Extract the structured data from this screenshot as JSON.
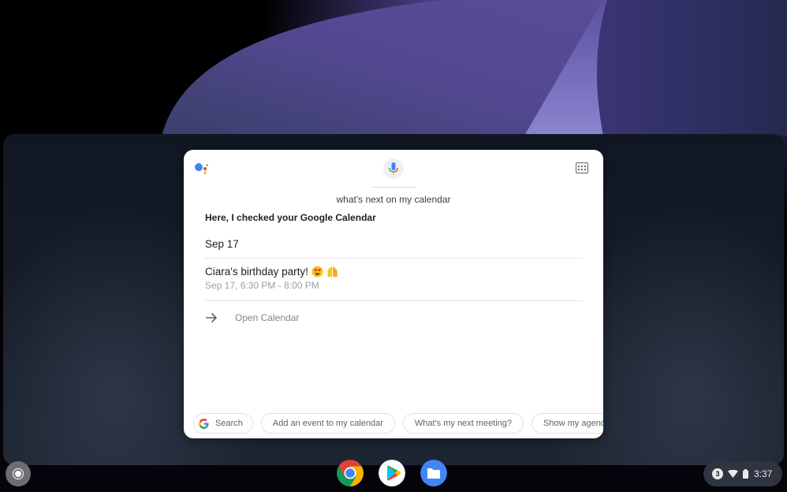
{
  "assistant": {
    "query": "what's next on my calendar",
    "response_title": "Here, I checked your Google Calendar",
    "date_header": "Sep 17",
    "event": {
      "title": "Ciara's birthday party!",
      "emojis": [
        "heart-eyes-emoji",
        "raised-hands-emoji"
      ],
      "time": "Sep 17, 6:30 PM - 8:00 PM"
    },
    "open_calendar_label": "Open Calendar",
    "chips": [
      {
        "label": "Search",
        "icon": "google-g-icon"
      },
      {
        "label": "Add an event to my calendar"
      },
      {
        "label": "What's my next meeting?"
      },
      {
        "label": "Show my agenda for"
      }
    ]
  },
  "shelf": {
    "apps": [
      {
        "name": "Chrome",
        "icon": "chrome-icon"
      },
      {
        "name": "Play Store",
        "icon": "play-store-icon"
      },
      {
        "name": "Files",
        "icon": "files-icon"
      }
    ],
    "status": {
      "notification_count": "3",
      "time": "3:37"
    }
  },
  "colors": {
    "google_blue": "#4285f4",
    "google_red": "#ea4335",
    "google_yellow": "#fbbc04",
    "google_green": "#34a853"
  }
}
